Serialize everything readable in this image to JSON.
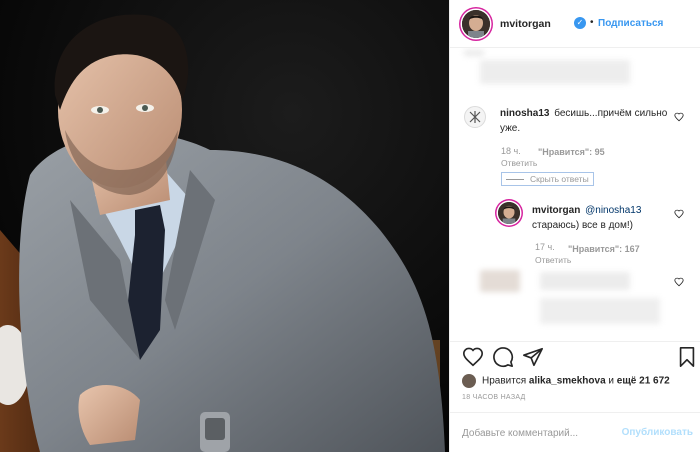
{
  "post": {
    "author": "mvitorgan",
    "follow_label": "Подписаться",
    "dot": "•",
    "verified_glyph": "✓"
  },
  "comments": [
    {
      "username": "ninosha13",
      "text": "бесишь...причём сильно уже.",
      "age": "18 ч.",
      "likes": "\"Нравится\": 95",
      "reply_label": "Ответить"
    }
  ],
  "hide_replies_label": "Скрыть ответы",
  "replies": [
    {
      "username": "mvitorgan",
      "mention": "@ninosha13",
      "text": "стараюсь) все в дом!)",
      "age": "17 ч.",
      "likes": "\"Нравится\": 167",
      "reply_label": "Ответить"
    }
  ],
  "likes_line": {
    "prefix": "Нравится",
    "user": "alika_smekhova",
    "middle": "и",
    "count": "ещё 21 672"
  },
  "timestamp": "18 ЧАСОВ НАЗАД",
  "add_comment": {
    "placeholder": "Добавьте комментарий...",
    "publish_label": "Опубликовать"
  },
  "icons": [
    "heart-icon",
    "comment-icon",
    "share-icon",
    "bookmark-icon",
    "verified-icon"
  ],
  "colors": {
    "link": "#3897f0",
    "muted": "#999999",
    "text": "#262626",
    "publish_disabled": "#b2dffc"
  }
}
